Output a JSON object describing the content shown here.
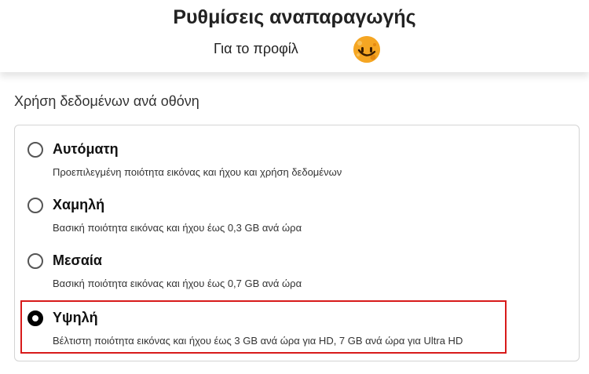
{
  "header": {
    "title": "Ρυθμίσεις αναπαραγωγής",
    "profile_label": "Για το προφίλ",
    "avatar_icon": "smiley-face-icon",
    "avatar_color": "#f5a623"
  },
  "section": {
    "title": "Χρήση δεδομένων ανά οθόνη"
  },
  "options": [
    {
      "label": "Αυτόματη",
      "description": "Προεπιλεγμένη ποιότητα εικόνας και ήχου και χρήση δεδομένων",
      "selected": false
    },
    {
      "label": "Χαμηλή",
      "description": "Βασική ποιότητα εικόνας και ήχου έως 0,3 GB ανά ώρα",
      "selected": false
    },
    {
      "label": "Μεσαία",
      "description": "Βασική ποιότητα εικόνας και ήχου έως 0,7 GB ανά ώρα",
      "selected": false
    },
    {
      "label": "Υψηλή",
      "description": "Βέλτιστη ποιότητα εικόνας και ήχου έως 3 GB ανά ώρα για HD, 7 GB ανά ώρα για Ultra HD",
      "selected": true
    }
  ],
  "colors": {
    "highlight": "#d81a1a"
  }
}
